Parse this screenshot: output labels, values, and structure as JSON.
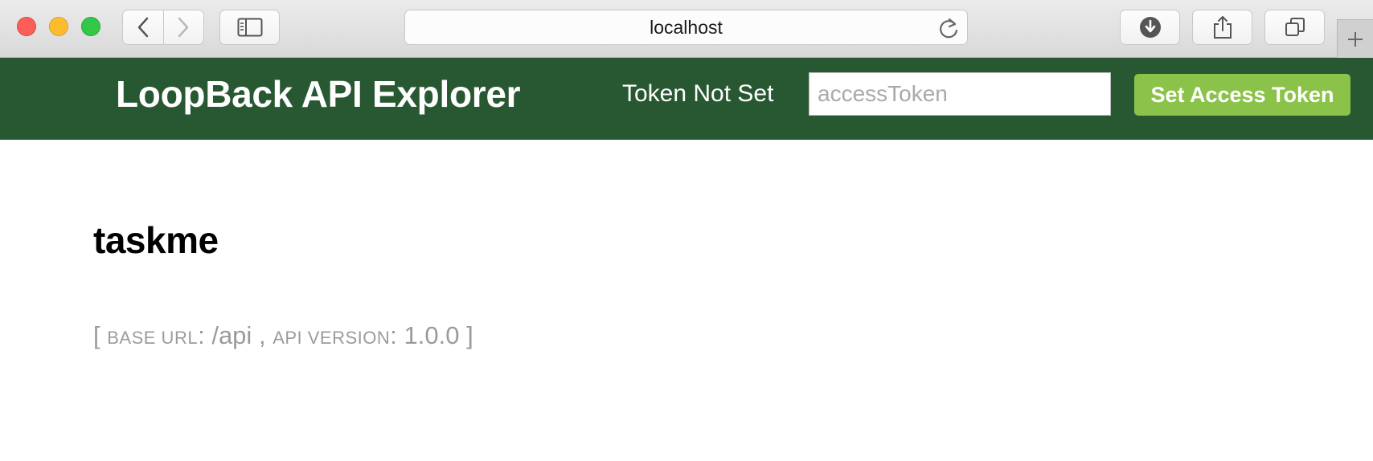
{
  "browser": {
    "address": "localhost",
    "icons": {
      "back": "chevron-left-icon",
      "forward": "chevron-right-icon",
      "sidebar": "sidebar-icon",
      "reload": "reload-icon",
      "download": "download-icon",
      "share": "share-icon",
      "tabs": "tabs-icon",
      "new_tab": "plus-icon"
    }
  },
  "header": {
    "title": "LoopBack API Explorer",
    "token_status": "Token Not Set",
    "token_placeholder": "accessToken",
    "token_value": "",
    "set_token_label": "Set Access Token"
  },
  "main": {
    "api_title": "taskme",
    "info": {
      "open_bracket": "[",
      "base_url_label": "base url",
      "colon1": ":",
      "base_url_value": "/api",
      "separator": ",",
      "api_version_label": "api version",
      "colon2": ":",
      "api_version_value": "1.0.0",
      "close_bracket": "]"
    }
  },
  "colors": {
    "header_bg": "#285831",
    "button_bg": "#8bc24a",
    "info_text": "#9b9b9b"
  }
}
